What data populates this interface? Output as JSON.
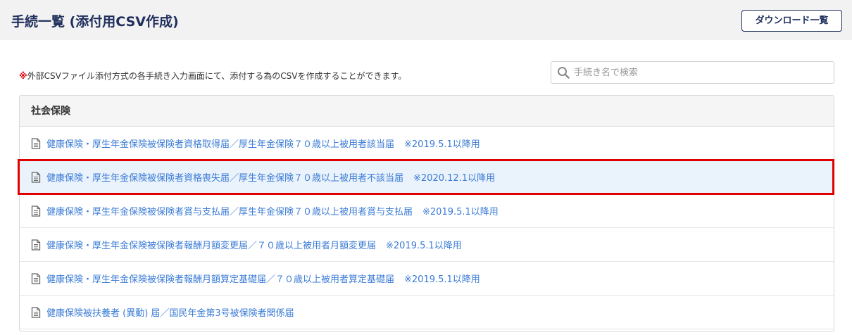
{
  "header": {
    "title": "手続一覧 (添付用CSV作成)",
    "download_label": "ダウンロード一覧"
  },
  "notice": {
    "mark": "※",
    "text": "外部CSVファイル添付方式の各手続き入力画面にて、添付する為のCSVを作成することができます。"
  },
  "search": {
    "icon": "search-icon",
    "placeholder": "手続き名で検索",
    "value": ""
  },
  "section": {
    "title": "社会保険",
    "items": [
      {
        "label": "健康保険・厚生年金保険被保険者資格取得届／厚生年金保険７０歳以上被用者該当届",
        "note": "※2019.5.1以降用",
        "highlighted": false
      },
      {
        "label": "健康保険・厚生年金保険被保険者資格喪失届／厚生年金保険７０歳以上被用者不該当届",
        "note": "※2020.12.1以降用",
        "highlighted": true
      },
      {
        "label": "健康保険・厚生年金保険被保険者賞与支払届／厚生年金保険７０歳以上被用者賞与支払届",
        "note": "※2019.5.1以降用",
        "highlighted": false
      },
      {
        "label": "健康保険・厚生年金保険被保険者報酬月額変更届／７０歳以上被用者月額変更届",
        "note": "※2019.5.1以降用",
        "highlighted": false
      },
      {
        "label": "健康保険・厚生年金保険被保険者報酬月額算定基礎届／７０歳以上被用者算定基礎届",
        "note": "※2019.5.1以降用",
        "highlighted": false
      },
      {
        "label": "健康保険被扶養者 (異動) 届／国民年金第3号被保険者関係届",
        "note": "",
        "highlighted": false
      }
    ]
  },
  "colors": {
    "title": "#1f2f5c",
    "link": "#3a7bd5",
    "highlight_bg": "#eaf2fb",
    "highlight_border": "#e00000",
    "notice_mark": "#e60012"
  }
}
